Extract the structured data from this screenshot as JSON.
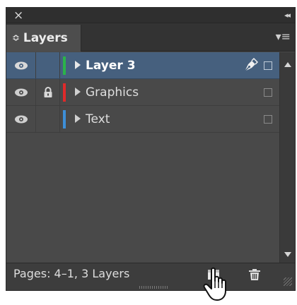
{
  "window": {
    "close_glyph": "×",
    "collapse_glyph": "◂◂"
  },
  "tab": {
    "updown_glyph": "≎",
    "label": "Layers",
    "menu_glyph": "▾≡"
  },
  "layers": [
    {
      "name": "Layer 3",
      "color": "#2bb34a",
      "visible": true,
      "locked": false,
      "selected": true,
      "targeted": true
    },
    {
      "name": "Graphics",
      "color": "#e02a2a",
      "visible": true,
      "locked": true,
      "selected": false,
      "targeted": false
    },
    {
      "name": "Text",
      "color": "#3d8fd8",
      "visible": true,
      "locked": false,
      "selected": false,
      "targeted": false
    }
  ],
  "footer": {
    "status": "Pages: 4–1, 3 Layers"
  },
  "colors": {
    "panel_bg": "#4a4a4a",
    "selection": "#46607e",
    "header": "#333333"
  }
}
